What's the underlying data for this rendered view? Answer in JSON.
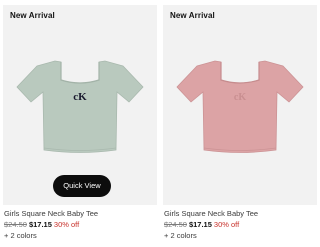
{
  "products": [
    {
      "badge": "New Arrival",
      "name": "Girls Square Neck Baby Tee",
      "original_price": "$24.50",
      "sale_price": "$17.15",
      "discount": "30% off",
      "colors": "+ 2 colors",
      "quick_view": "Quick View",
      "tee_color": "#b9c9be",
      "logo_color": "#1a1a2e"
    },
    {
      "badge": "New Arrival",
      "name": "Girls Square Neck Baby Tee",
      "original_price": "$24.50",
      "sale_price": "$17.15",
      "discount": "30% off",
      "colors": "+ 2 colors",
      "tee_color": "#dca3a5",
      "logo_color": "#c98f91"
    }
  ],
  "colors": {
    "image_bg": "#f2f2f2",
    "discount_red": "#c8312b",
    "quick_view_bg": "#0d0d0d"
  }
}
